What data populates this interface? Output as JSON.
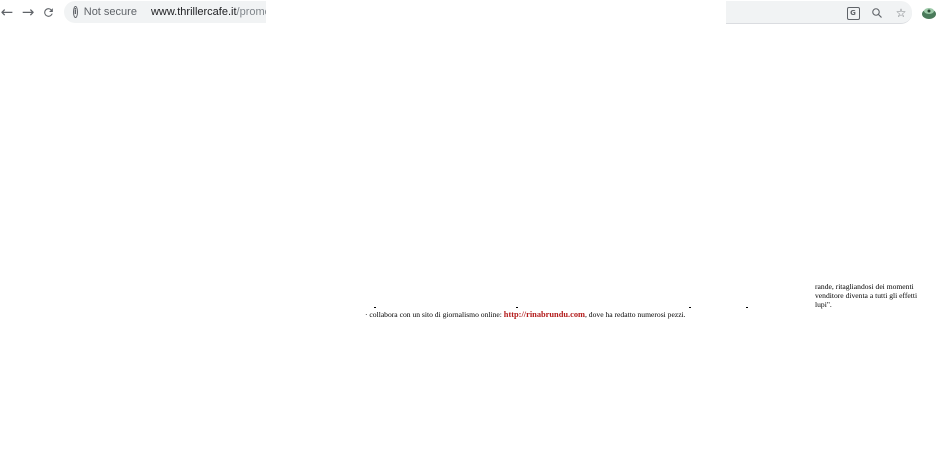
{
  "browser": {
    "icons": {
      "back": "back-arrow-icon",
      "forward": "forward-arrow-icon",
      "reload": "reload-icon",
      "info": "info-icon",
      "translate": "translate-icon",
      "zoom": "zoom-icon",
      "bookmark": "star-icon",
      "extension": "extension-icon"
    },
    "security_label": "Not secure",
    "url_host": "www.thrillercafe.it",
    "url_path": "/promo/"
  },
  "page": {
    "right_column": {
      "line1": "rande, ritagliandosi dei momenti",
      "line2": "venditore diventa a tutti gli effetti",
      "line3": "lupi\"."
    },
    "center_line": {
      "prefix": "· collabora con un sito di giornalismo online: ",
      "link": "http://rinabrundu.com",
      "suffix": ", dove ha redatto numerosi pezzi."
    }
  },
  "colors": {
    "link": "#b31b1b",
    "toolbar_icon": "#5f6368",
    "omnibox_bg": "#f1f3f4"
  }
}
